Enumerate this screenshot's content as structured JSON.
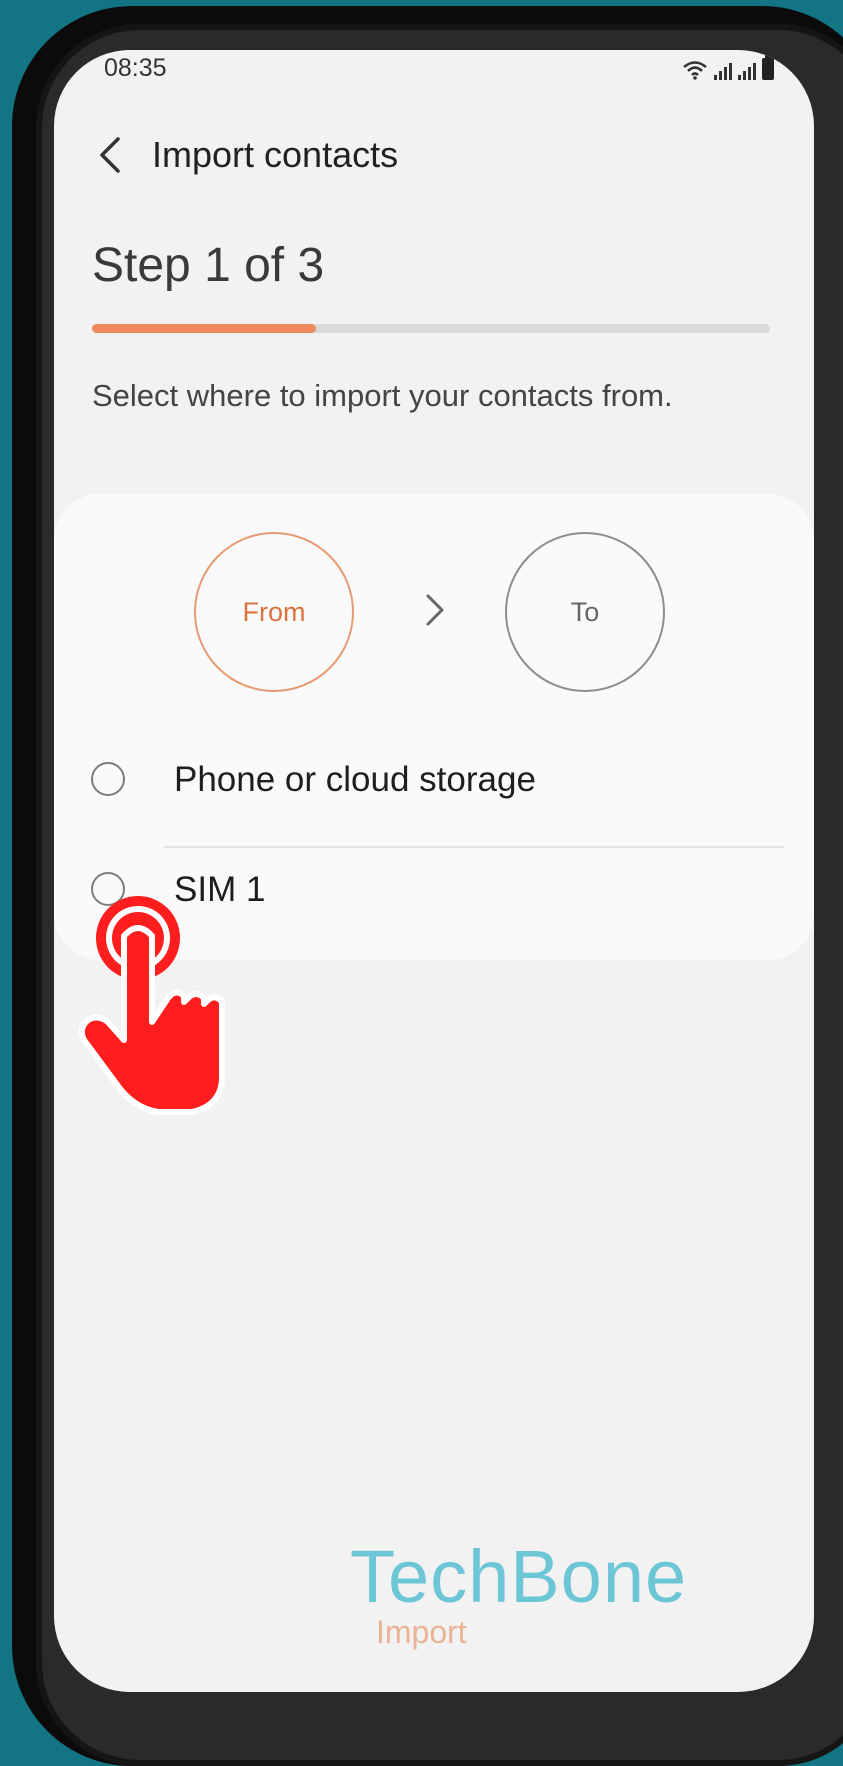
{
  "status": {
    "time": "08:35",
    "icons": [
      "wifi-icon",
      "signal-icon",
      "signal-icon",
      "battery-icon"
    ]
  },
  "app_bar": {
    "back_icon": "chevron-left-icon",
    "title": "Import contacts"
  },
  "wizard": {
    "step": "Step 1 of 3",
    "progress": 0.33,
    "instruction": "Select where to import your contacts from.",
    "from_label": "From",
    "to_label": "To",
    "arrow_icon": "chevron-right-icon"
  },
  "options": [
    {
      "label": "Phone or cloud storage",
      "selected": false
    },
    {
      "label": "SIM 1",
      "selected": false
    }
  ],
  "footer": {
    "action_label": "Import"
  },
  "watermark": "TechBone",
  "colors": {
    "accent": "#ee8a5b",
    "from_text": "#d9743f",
    "hand": "#ff1e1e",
    "watermark": "#5fc2d2",
    "background": "#137584"
  }
}
